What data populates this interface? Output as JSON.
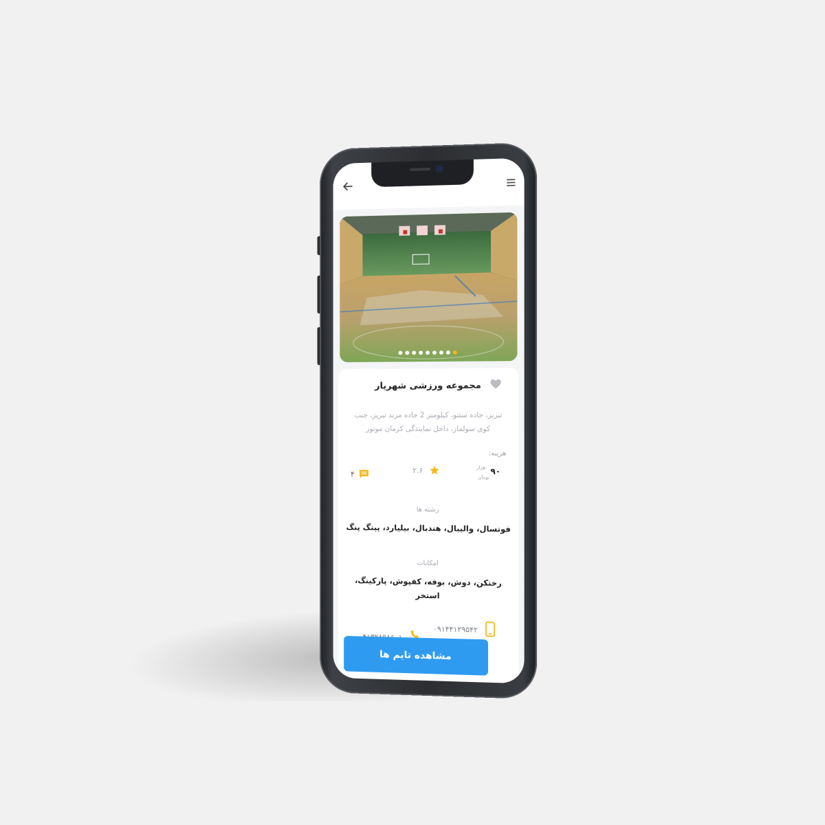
{
  "venue": {
    "title": "مجموعه ورزشی شهریار",
    "address": "تبریز، جاده ستنو، کیلومتر 2 جاده مرند تبریز، جنب کوی سولماز، داخل نمایندگی کرمان موتور",
    "price_label": "هزینه:",
    "price_value": "۹۰",
    "price_unit_1": "هزار",
    "price_unit_2": "تومان",
    "rating": "۲.۶",
    "comments_count": "۴"
  },
  "sports": {
    "label": "رشته ها",
    "value": "فوتسال، والیبال، هندبال، بیلیارد، پینگ پنگ"
  },
  "facilities": {
    "label": "امکانات",
    "value": "رختکن، دوش، بوفه، کفپوش، پارکینگ، استخر"
  },
  "contact": {
    "mobile": "۰۹۱۴۴۱۲۹۵۴۲",
    "phone": "۰۴۱۳۲۸۹۸۶۰۱"
  },
  "cta": {
    "label": "مشاهده تایم ها"
  },
  "gallery": {
    "dots_count": 9,
    "active_index": 8
  },
  "icons": [
    "back-arrow-icon",
    "menu-icon",
    "heart-icon",
    "star-icon",
    "comment-icon",
    "mobile-icon",
    "phone-icon"
  ],
  "colors": {
    "accent": "#2f9bf0",
    "star": "#f5b81b",
    "heart": "#b9bcc1"
  }
}
